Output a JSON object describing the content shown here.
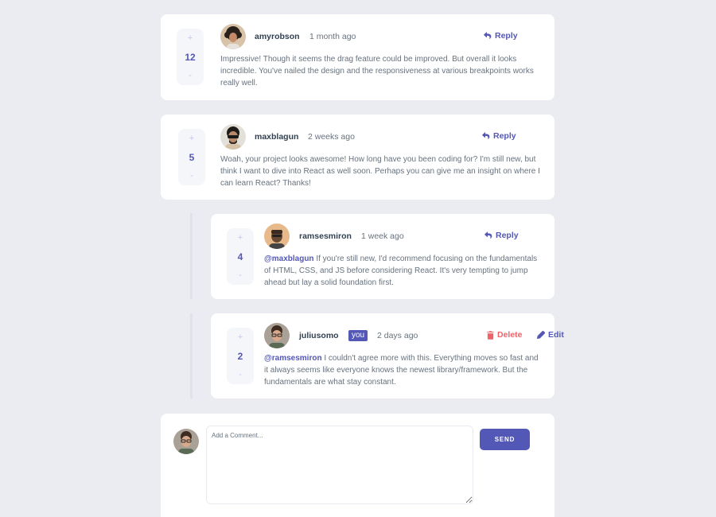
{
  "colors": {
    "background": "#eaecf1",
    "accent": "#5357b6",
    "delete": "#ed6368",
    "username": "#324152",
    "body_text": "#67727e",
    "vote_bg": "#f5f6fa"
  },
  "comments": [
    {
      "score": "12",
      "username": "amyrobson",
      "created_at": "1 month ago",
      "reply_label": "Reply",
      "content": "Impressive! Though it seems the drag feature could be improved. But overall it looks incredible. You've nailed the design and the responsiveness at various breakpoints works really well.",
      "avatar": "avatar-amyrobson"
    },
    {
      "score": "5",
      "username": "maxblagun",
      "created_at": "2 weeks ago",
      "reply_label": "Reply",
      "content": "Woah, your project looks awesome! How long have you been coding for? I'm still new, but think I want to dive into React as well soon. Perhaps you can give me an insight on where I can learn React? Thanks!",
      "avatar": "avatar-maxblagun"
    }
  ],
  "replies": [
    {
      "score": "4",
      "username": "ramsesmiron",
      "created_at": "1 week ago",
      "reply_label": "Reply",
      "replying_to": "@maxblagun",
      "content": "If you're still new, I'd recommend focusing on the fundamentals of HTML, CSS, and JS before considering React. It's very tempting to jump ahead but lay a solid foundation first.",
      "avatar": "avatar-ramsesmiron"
    },
    {
      "score": "2",
      "username": "juliusomo",
      "you_badge": "you",
      "created_at": "2 days ago",
      "delete_label": "Delete",
      "edit_label": "Edit",
      "replying_to": "@ramsesmiron",
      "content": "I couldn't agree more with this. Everything moves so fast and it always seems like everyone knows the newest library/framework. But the fundamentals are what stay constant.",
      "avatar": "avatar-juliusomo"
    }
  ],
  "vote": {
    "plus": "+",
    "minus": "-"
  },
  "new_comment": {
    "placeholder": "Add a Comment...",
    "send_label": "SEND",
    "avatar": "avatar-juliusomo"
  }
}
